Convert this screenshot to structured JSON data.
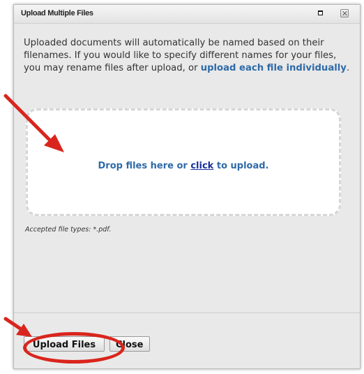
{
  "dialog": {
    "title": "Upload Multiple Files",
    "info_parts": {
      "text": "Uploaded documents will automatically be named based on their filenames. If you would like to specify different names for your files, you may rename files after upload, or ",
      "link": "upload each file individually",
      "end": "."
    },
    "dropzone": {
      "text_before": "Drop files here or ",
      "link": "click",
      "text_after": " to upload."
    },
    "accepted_types": "Accepted file types: *.pdf.",
    "buttons": {
      "upload": "Upload Files",
      "close": "Close"
    }
  },
  "icons": {
    "maximize": "maximize-icon",
    "close": "close-icon"
  },
  "colors": {
    "link": "#2f6aa8",
    "annotation": "#d9251d"
  }
}
